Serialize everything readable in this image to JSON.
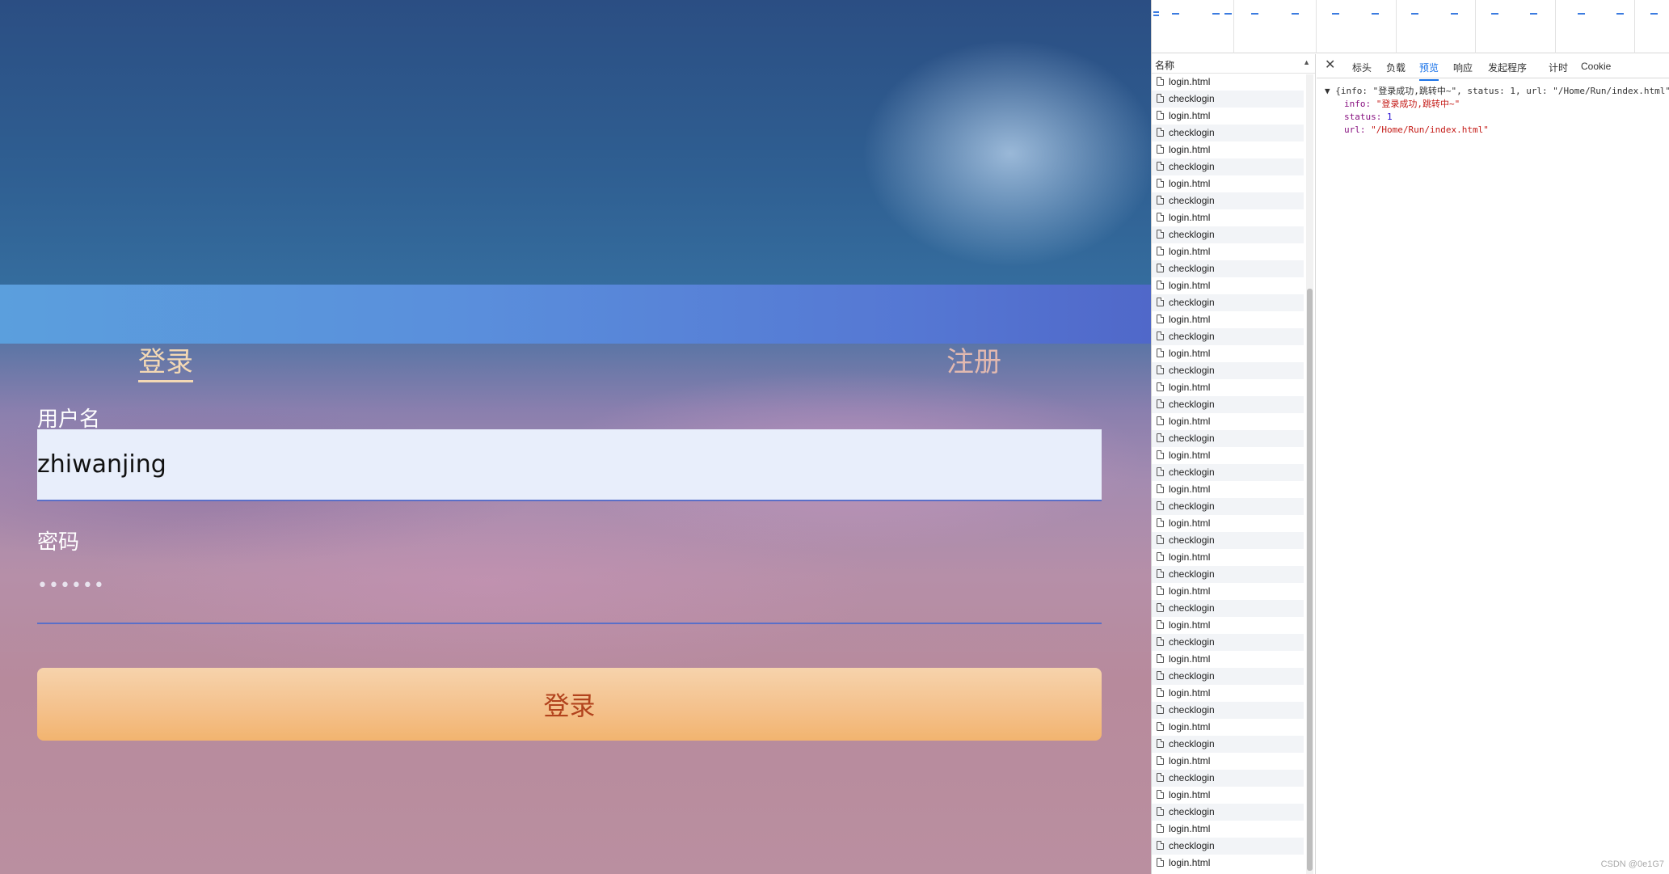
{
  "login": {
    "tabs": {
      "login": "登录",
      "register": "注册"
    },
    "username_label": "用户名",
    "username_value": "zhiwanjing",
    "password_label": "密码",
    "password_mask": "••••••",
    "submit_label": "登录"
  },
  "devtools": {
    "name_column_header": "名称",
    "requests": [
      "login.html",
      "checklogin",
      "login.html",
      "checklogin",
      "login.html",
      "checklogin",
      "login.html",
      "checklogin",
      "login.html",
      "checklogin",
      "login.html",
      "checklogin",
      "login.html",
      "checklogin",
      "login.html",
      "checklogin",
      "login.html",
      "checklogin",
      "login.html",
      "checklogin",
      "login.html",
      "checklogin",
      "login.html",
      "checklogin",
      "login.html",
      "checklogin",
      "login.html",
      "checklogin",
      "login.html",
      "checklogin",
      "login.html",
      "checklogin",
      "login.html",
      "checklogin",
      "login.html",
      "checklogin",
      "login.html",
      "checklogin",
      "login.html",
      "checklogin",
      "login.html",
      "checklogin",
      "login.html",
      "checklogin",
      "login.html",
      "checklogin",
      "login.html"
    ],
    "detail_tabs": [
      "标头",
      "负载",
      "预览",
      "响应",
      "发起程序",
      "计时",
      "Cookie"
    ],
    "active_tab": "预览",
    "preview": {
      "summary": "{info: \"登录成功,跳转中~\", status: 1, url: \"/Home/Run/index.html\"}",
      "info_key": "info:",
      "info_value": "\"登录成功,跳转中~\"",
      "status_key": "status:",
      "status_value": "1",
      "url_key": "url:",
      "url_value": "\"/Home/Run/index.html\""
    },
    "watermark": "CSDN @0e1G7"
  },
  "colors": {
    "header_band": "#5a8fdc",
    "submit_button": "#f4c08a",
    "submit_text": "#b2431d",
    "devtools_active": "#1a73e8"
  }
}
